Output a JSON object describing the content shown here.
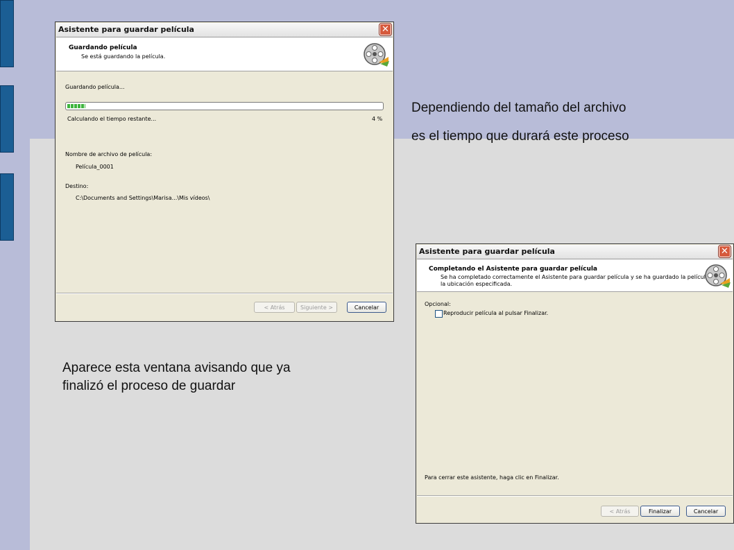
{
  "notes": {
    "top_right_line1": "Dependiendo del tamaño del archivo",
    "top_right_line2": "es el tiempo que durará este proceso",
    "bottom_left_line1": "Aparece esta ventana avisando que ya",
    "bottom_left_line2": "finalizó el proceso de guardar"
  },
  "saving_window": {
    "title": "Asistente para guardar película",
    "close_glyph": "✕",
    "header_title": "Guardando película",
    "header_subtitle": "Se está guardando la película.",
    "status_label": "Guardando película...",
    "progress_percent": 4,
    "time_label": "Calculando el tiempo restante...",
    "percent_label": "4 %",
    "filename_label": "Nombre de archivo de película:",
    "filename_value": "Película_0001",
    "destination_label": "Destino:",
    "destination_value": "C:\\Documents and Settings\\Marisa...\\Mis vídeos\\",
    "buttons": {
      "back": "< Atrás",
      "next": "Siguiente >",
      "cancel": "Cancelar"
    },
    "icon": "film-reel-icon"
  },
  "finish_window": {
    "title": "Asistente para guardar película",
    "close_glyph": "✕",
    "header_title": "Completando el Asistente para guardar película",
    "header_subtitle_line1": "Se ha completado correctamente el Asistente para guardar película y se ha guardado la película en",
    "header_subtitle_line2": "la ubicación especificada.",
    "optional_label": "Opcional:",
    "checkbox_label": "Reproducir película al pulsar Finalizar.",
    "checkbox_checked": false,
    "footer_text": "Para cerrar este asistente, haga clic en Finalizar.",
    "buttons": {
      "back": "< Atrás",
      "finish": "Finalizar",
      "cancel": "Cancelar"
    },
    "icon": "film-reel-icon"
  },
  "colors": {
    "slide_band": "#b8bcd8",
    "slide_body": "#dcdcdc",
    "deco_blue": "#1b5e94",
    "progress_green": "#3eb53e"
  }
}
